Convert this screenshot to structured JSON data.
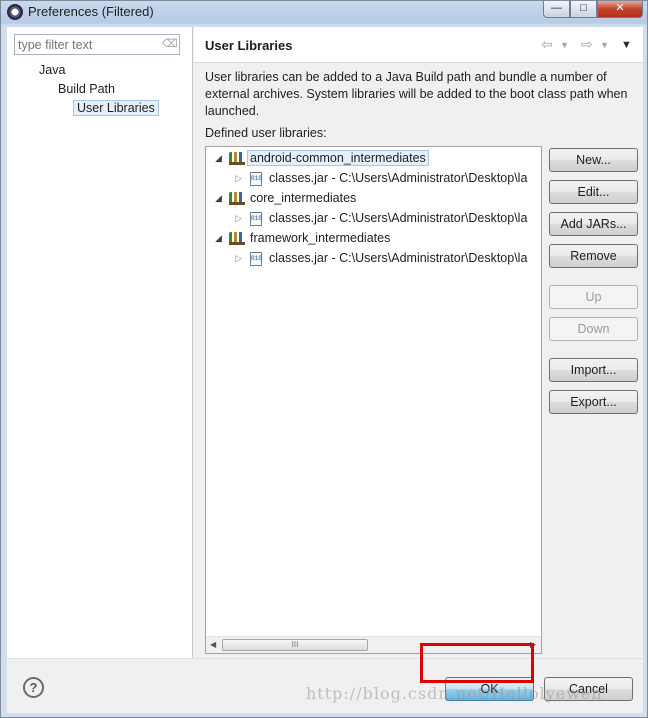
{
  "window": {
    "title": "Preferences (Filtered)",
    "controls": {
      "minimize": "—",
      "maximize": "□",
      "close": "✕"
    }
  },
  "sidebar": {
    "filter_placeholder": "type filter text",
    "tree": [
      {
        "label": "Java"
      },
      {
        "label": "Build Path"
      },
      {
        "label": "User Libraries",
        "selected": true
      }
    ]
  },
  "page": {
    "title": "User Libraries",
    "description": "User libraries can be added to a Java Build path and bundle a number of external archives. System libraries will be added to the boot class path when launched.",
    "defined_label": "Defined user libraries:",
    "libraries": [
      {
        "name": "android-common_intermediates",
        "selected": true,
        "jar": "classes.jar - C:\\Users\\Administrator\\Desktop\\la"
      },
      {
        "name": "core_intermediates",
        "jar": "classes.jar - C:\\Users\\Administrator\\Desktop\\la"
      },
      {
        "name": "framework_intermediates",
        "jar": "classes.jar - C:\\Users\\Administrator\\Desktop\\la"
      }
    ],
    "jar_icon_text": "010",
    "scroll_thumb": "III",
    "buttons": {
      "new": "New...",
      "edit": "Edit...",
      "add_jars": "Add JARs...",
      "remove": "Remove",
      "up": "Up",
      "down": "Down",
      "import": "Import...",
      "export": "Export..."
    }
  },
  "dialog": {
    "help": "?",
    "ok": "OK",
    "cancel": "Cancel"
  },
  "watermark": "http://blog.csdn.net/Hellolyewen",
  "colors": {
    "highlight_border": "#e00000",
    "ok_button": "#98d1ef",
    "selection": "#e5f0fb"
  }
}
